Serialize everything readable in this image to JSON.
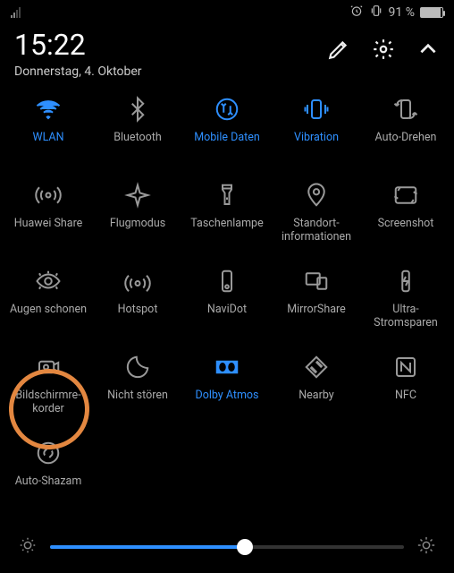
{
  "status": {
    "battery_pct": "91 %",
    "battery_fill_pct": 91
  },
  "header": {
    "time": "15:22",
    "date": "Donnerstag, 4. Oktober"
  },
  "tiles": [
    {
      "id": "wlan",
      "label": "WLAN",
      "active": true
    },
    {
      "id": "bluetooth",
      "label": "Bluetooth",
      "active": false
    },
    {
      "id": "mobile-data",
      "label": "Mobile Daten",
      "active": true
    },
    {
      "id": "vibration",
      "label": "Vibration",
      "active": true
    },
    {
      "id": "auto-rotate",
      "label": "Auto-Drehen",
      "active": false
    },
    {
      "id": "huawei-share",
      "label": "Huawei Share",
      "active": false
    },
    {
      "id": "airplane",
      "label": "Flugmodus",
      "active": false
    },
    {
      "id": "flashlight",
      "label": "Taschenlampe",
      "active": false
    },
    {
      "id": "location",
      "label": "Standort­informationen",
      "active": false
    },
    {
      "id": "screenshot",
      "label": "Screenshot",
      "active": false
    },
    {
      "id": "eye-comfort",
      "label": "Augen schonen",
      "active": false
    },
    {
      "id": "hotspot",
      "label": "Hotspot",
      "active": false
    },
    {
      "id": "navidot",
      "label": "NaviDot",
      "active": false
    },
    {
      "id": "mirrorshare",
      "label": "MirrorShare",
      "active": false
    },
    {
      "id": "ultra-power",
      "label": "Ultra-Stromsparen",
      "active": false
    },
    {
      "id": "screen-rec",
      "label": "Bildschirmre­korder",
      "active": false
    },
    {
      "id": "dnd",
      "label": "Nicht stören",
      "active": false
    },
    {
      "id": "dolby",
      "label": "Dolby Atmos",
      "active": true
    },
    {
      "id": "nearby",
      "label": "Nearby",
      "active": false
    },
    {
      "id": "nfc",
      "label": "NFC",
      "active": false
    },
    {
      "id": "auto-shazam",
      "label": "Auto-Shazam",
      "active": false
    }
  ],
  "brightness": {
    "value_pct": 55
  }
}
